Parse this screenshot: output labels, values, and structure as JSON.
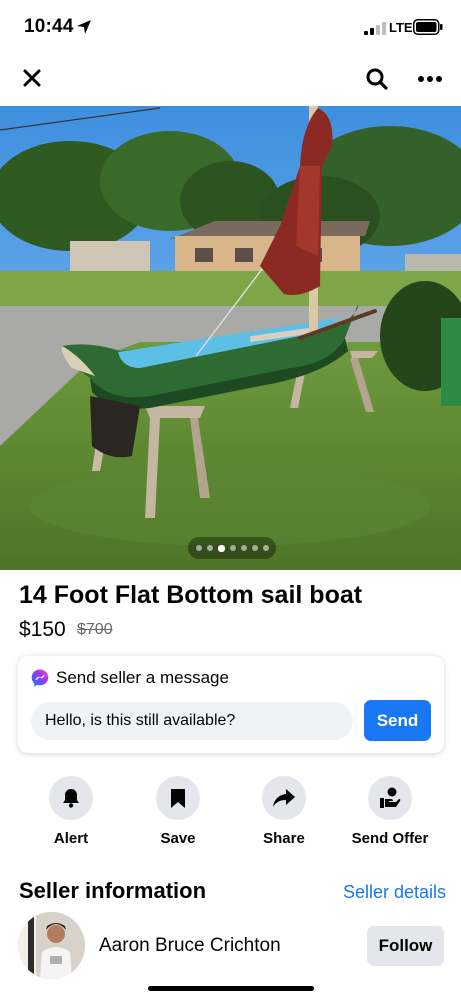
{
  "status_bar": {
    "time": "10:44",
    "network": "LTE",
    "icons": [
      "location-arrow-icon",
      "signal-icon",
      "battery-icon"
    ]
  },
  "nav": {
    "icons": [
      "close-icon",
      "search-icon",
      "more-icon"
    ]
  },
  "photo": {
    "image_count": 7,
    "active_index": 2
  },
  "listing": {
    "title": "14 Foot Flat Bottom sail boat",
    "price": "$150",
    "original_price": "$700"
  },
  "message": {
    "header": "Send seller a message",
    "input_value": "Hello, is this still available?",
    "send_label": "Send"
  },
  "actions": [
    {
      "label": "Alert",
      "icon": "bell-icon"
    },
    {
      "label": "Save",
      "icon": "bookmark-icon"
    },
    {
      "label": "Share",
      "icon": "share-arrow-icon"
    },
    {
      "label": "Send Offer",
      "icon": "offer-hand-icon"
    }
  ],
  "seller": {
    "heading": "Seller information",
    "details_link": "Seller details",
    "name": "Aaron Bruce Crichton",
    "follow_label": "Follow"
  },
  "colors": {
    "accent": "#1877f2",
    "button_gray": "#e4e6eb",
    "input_gray": "#f0f2f5"
  }
}
